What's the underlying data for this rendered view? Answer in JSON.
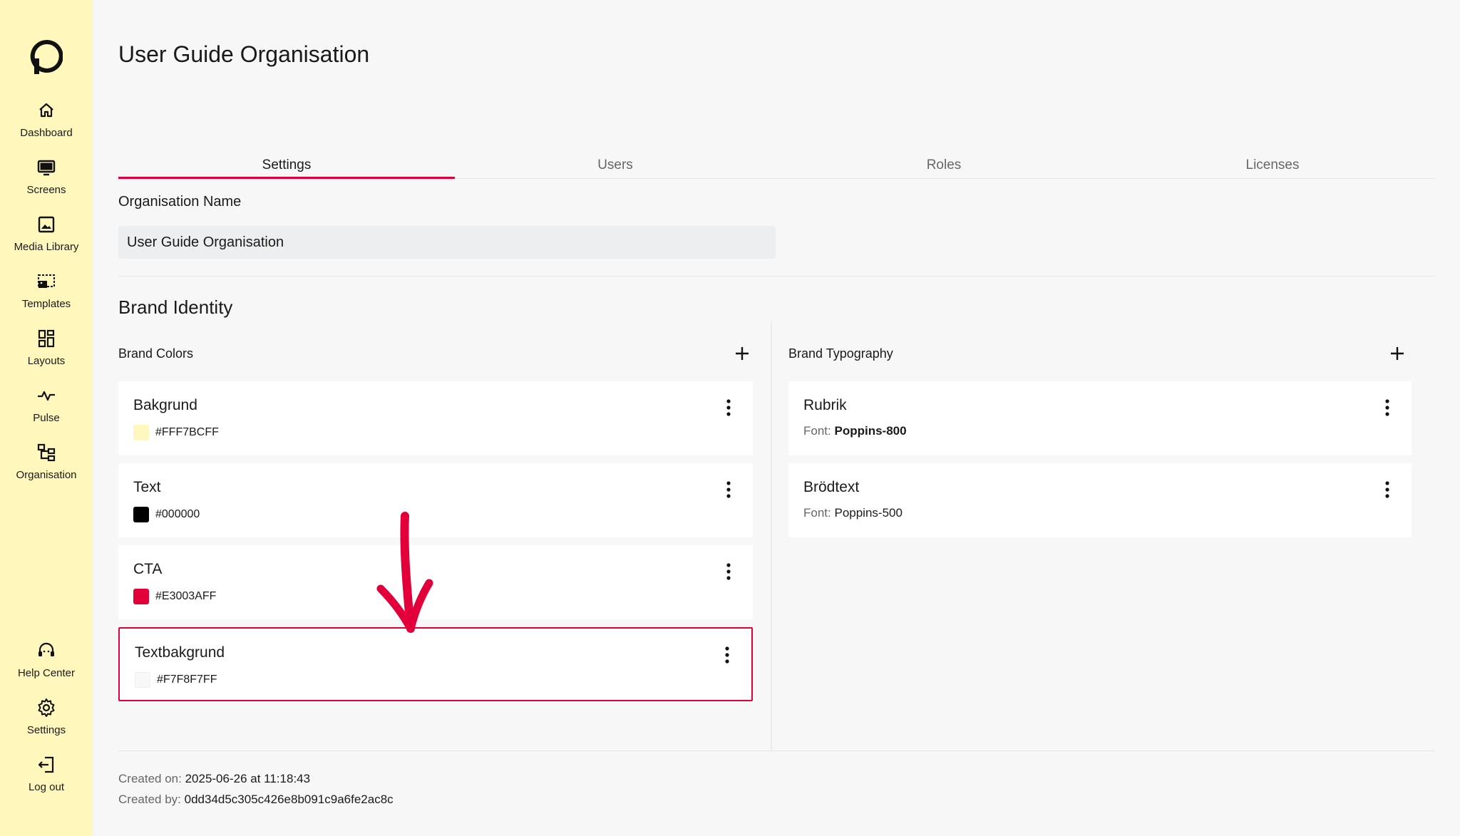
{
  "sidebar": {
    "items": [
      {
        "label": "Dashboard",
        "icon": "home-icon"
      },
      {
        "label": "Screens",
        "icon": "monitor-icon"
      },
      {
        "label": "Media Library",
        "icon": "image-icon"
      },
      {
        "label": "Templates",
        "icon": "template-icon"
      },
      {
        "label": "Layouts",
        "icon": "layout-icon"
      },
      {
        "label": "Pulse",
        "icon": "pulse-icon"
      },
      {
        "label": "Organisation",
        "icon": "organisation-icon"
      }
    ],
    "bottom_items": [
      {
        "label": "Help Center",
        "icon": "help-icon"
      },
      {
        "label": "Settings",
        "icon": "gear-icon"
      },
      {
        "label": "Log out",
        "icon": "logout-icon"
      }
    ]
  },
  "page": {
    "title": "User Guide Organisation"
  },
  "tabs": [
    {
      "label": "Settings",
      "active": true
    },
    {
      "label": "Users",
      "active": false
    },
    {
      "label": "Roles",
      "active": false
    },
    {
      "label": "Licenses",
      "active": false
    }
  ],
  "settings": {
    "org_name_label": "Organisation Name",
    "org_name_value": "User Guide Organisation",
    "brand_identity_title": "Brand Identity",
    "brand_colors_label": "Brand Colors",
    "brand_typography_label": "Brand Typography",
    "colors": [
      {
        "name": "Bakgrund",
        "hex": "#FFF7BCFF",
        "swatch": "#FFF7BC"
      },
      {
        "name": "Text",
        "hex": "#000000",
        "swatch": "#000000"
      },
      {
        "name": "CTA",
        "hex": "#E3003AFF",
        "swatch": "#E3003A"
      },
      {
        "name": "Textbakgrund",
        "hex": "#F7F8F7FF",
        "swatch": "#F7F8F7",
        "highlighted": true
      }
    ],
    "typography": [
      {
        "name": "Rubrik",
        "font_prefix": "Font:",
        "font": "Poppins-800"
      },
      {
        "name": "Brödtext",
        "font_prefix": "Font:",
        "font": "Poppins-500"
      }
    ]
  },
  "meta": {
    "created_on_label": "Created on:",
    "created_on_value": "2025-06-26 at 11:18:43",
    "created_by_label": "Created by:",
    "created_by_value": "0dd34d5c305c426e8b091c9a6fe2ac8c"
  },
  "colors": {
    "sidebar_bg": "#FFF7BC",
    "accent": "#E3003A",
    "page_bg": "#F7F7F7"
  }
}
